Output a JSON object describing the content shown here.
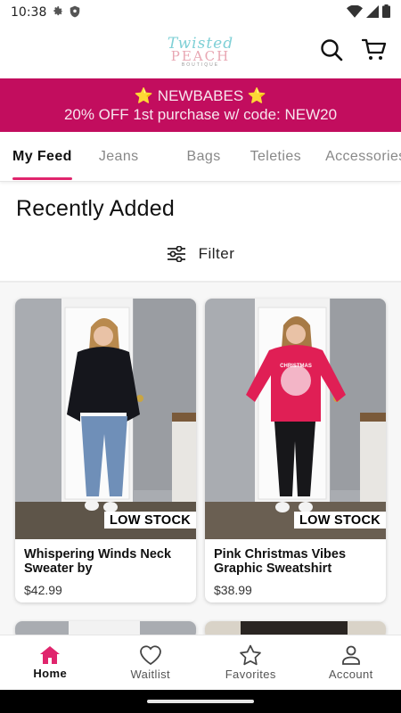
{
  "status_bar": {
    "time": "10:38"
  },
  "brand": {
    "line1": "Twisted",
    "line2": "PEACH",
    "line3": "BOUTIQUE"
  },
  "promo": {
    "line1": "⭐ NEWBABES ⭐",
    "line2": "20% OFF 1st purchase w/ code: NEW20",
    "color": "#c20d5e"
  },
  "tabs": [
    {
      "label": "My Feed",
      "active": true
    },
    {
      "label": "Jeans"
    },
    {
      "label": "Bags"
    },
    {
      "label": "Teleties"
    },
    {
      "label": "Accessories"
    }
  ],
  "section": {
    "title": "Recently Added",
    "filter_label": "Filter"
  },
  "products": [
    {
      "name": "Whispering Winds Neck Sweater by",
      "price": "$42.99",
      "badge": "LOW STOCK",
      "garment_color": "#15161c"
    },
    {
      "name": "Pink Christmas Vibes Graphic Sweatshirt",
      "price": "$38.99",
      "badge": "LOW STOCK",
      "garment_color": "#e01f55",
      "print_text": "CHRISTMAS"
    }
  ],
  "bottom_nav": [
    {
      "label": "Home",
      "icon": "home-icon",
      "active": true
    },
    {
      "label": "Waitlist",
      "icon": "heart-icon"
    },
    {
      "label": "Favorites",
      "icon": "star-icon"
    },
    {
      "label": "Account",
      "icon": "person-icon"
    }
  ],
  "colors": {
    "accent": "#e0256d",
    "promo_bg": "#c20d5e"
  }
}
